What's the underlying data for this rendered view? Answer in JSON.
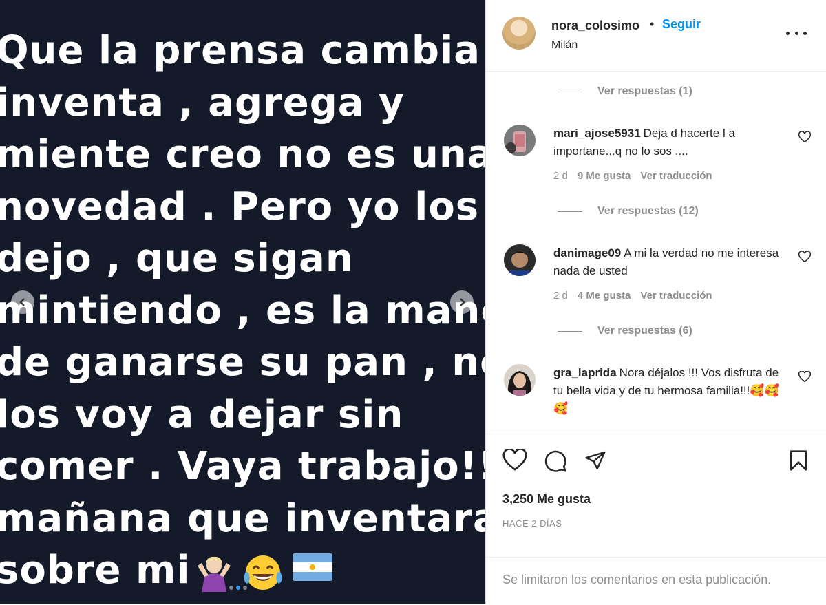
{
  "media": {
    "lines": [
      "Que la prensa cambia ,",
      "inventa , agrega y",
      "miente creo no es una",
      "novedad . Pero yo los",
      "dejo , que sigan",
      "mintiendo , es la manera",
      "de ganarse su pan , no",
      "los voy a dejar sin",
      "comer . Vaya trabajo!!! ,",
      "mañana que inventaran",
      "sobre mi"
    ],
    "emojis": [
      "person-shrugging-emoji",
      "tears-of-joy-emoji",
      "argentina-flag-emoji"
    ],
    "carousel": {
      "total": 3,
      "active": 2
    }
  },
  "header": {
    "username": "nora_colosimo",
    "separator": "•",
    "follow_label": "Seguir",
    "location": "Milán"
  },
  "comments": [
    {
      "view_replies": "Ver respuestas (1)"
    },
    {
      "username": "mari_ajose5931",
      "text": "Deja d hacerte l a importane...q no lo sos ....",
      "age": "2 d",
      "likes": "9 Me gusta",
      "translate": "Ver traducción",
      "view_replies": "Ver respuestas (12)"
    },
    {
      "username": "danimage09",
      "text": "A mi la verdad no me interesa nada de usted",
      "age": "2 d",
      "likes": "4 Me gusta",
      "translate": "Ver traducción",
      "view_replies": "Ver respuestas (6)"
    },
    {
      "username": "gra_laprida",
      "text": "Nora déjalos !!! Vos disfruta de tu bella vida y de tu hermosa familia!!!",
      "emojis": "🥰🥰🥰"
    }
  ],
  "actions": {
    "likes_count": "3,250 Me gusta",
    "date": "HACE 2 DÍAS",
    "comments_limited": "Se limitaron los comentarios en esta publicación."
  },
  "colors": {
    "media_bg": "#151a2b",
    "link_blue": "#0095f6",
    "muted_text": "#8e8e8e",
    "dark_text": "#262626"
  }
}
